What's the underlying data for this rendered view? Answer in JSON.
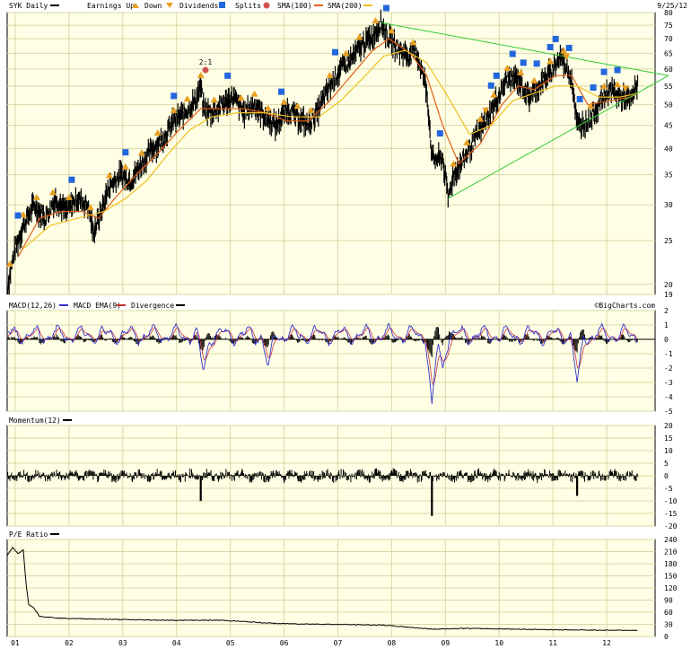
{
  "header": {
    "ticker_label": "SYK Daily",
    "earnings_up_label": "Earnings Up",
    "earnings_down_label": "Down",
    "dividends_label": "Dividends",
    "splits_label": "Splits",
    "sma100_label": "SMA(100)",
    "sma200_label": "SMA(200)",
    "date": "9/25/12"
  },
  "colors": {
    "price": "#000000",
    "sma100": "#e0601a",
    "sma200": "#f0c020",
    "trendline": "#33cc33",
    "panel_bg": "#ffffe5",
    "grid": "#d8d8a8",
    "macd": "#3333cc",
    "macd_ema": "#cc3333",
    "earnings_marker": "#e8a020",
    "dividend_marker": "#2266dd",
    "split_marker": "#d05050"
  },
  "split_annotation": "2:1",
  "watermark": "©BigCharts.com",
  "macd_panel": {
    "macd_label": "MACD(12,26)",
    "ema_label": "MACD EMA(9)",
    "divergence_label": "Divergence"
  },
  "momentum_panel": {
    "label": "Momentum(12)"
  },
  "pe_panel": {
    "label": "P/E Ratio"
  },
  "chart_data": [
    {
      "type": "line",
      "title": "SYK Daily",
      "x": [
        "01",
        "02",
        "03",
        "04",
        "05",
        "06",
        "07",
        "08",
        "09",
        "10",
        "11",
        "12"
      ],
      "yscale": "log",
      "ylim": [
        19,
        80
      ],
      "yticks": [
        "80",
        "75",
        "70",
        "65",
        "60",
        "55",
        "50",
        "45",
        "40",
        "35",
        "30",
        "25",
        "20",
        "19"
      ],
      "series": [
        {
          "name": "SYK Daily",
          "points": [
            [
              2001.0,
              19.5
            ],
            [
              2001.15,
              24
            ],
            [
              2001.3,
              27
            ],
            [
              2001.5,
              30
            ],
            [
              2001.7,
              28
            ],
            [
              2001.9,
              31
            ],
            [
              2002.1,
              29
            ],
            [
              2002.3,
              31
            ],
            [
              2002.5,
              30
            ],
            [
              2002.6,
              26
            ],
            [
              2002.75,
              29
            ],
            [
              2002.9,
              33
            ],
            [
              2003.1,
              35
            ],
            [
              2003.3,
              34
            ],
            [
              2003.5,
              37
            ],
            [
              2003.7,
              40
            ],
            [
              2003.9,
              42
            ],
            [
              2004.1,
              46
            ],
            [
              2004.3,
              48
            ],
            [
              2004.5,
              51
            ],
            [
              2004.6,
              55
            ],
            [
              2004.65,
              49
            ],
            [
              2004.8,
              48
            ],
            [
              2005.0,
              50
            ],
            [
              2005.2,
              52
            ],
            [
              2005.4,
              48
            ],
            [
              2005.6,
              50
            ],
            [
              2005.8,
              47
            ],
            [
              2006.0,
              45
            ],
            [
              2006.2,
              49
            ],
            [
              2006.4,
              47
            ],
            [
              2006.6,
              45
            ],
            [
              2006.8,
              49
            ],
            [
              2007.0,
              55
            ],
            [
              2007.2,
              60
            ],
            [
              2007.4,
              63
            ],
            [
              2007.6,
              68
            ],
            [
              2007.8,
              71
            ],
            [
              2007.95,
              76
            ],
            [
              2008.1,
              70
            ],
            [
              2008.3,
              66
            ],
            [
              2008.5,
              64
            ],
            [
              2008.6,
              66
            ],
            [
              2008.8,
              54
            ],
            [
              2008.9,
              38
            ],
            [
              2009.1,
              38
            ],
            [
              2009.2,
              31
            ],
            [
              2009.3,
              35
            ],
            [
              2009.5,
              38
            ],
            [
              2009.7,
              42
            ],
            [
              2009.9,
              46
            ],
            [
              2010.1,
              51
            ],
            [
              2010.3,
              57
            ],
            [
              2010.5,
              57
            ],
            [
              2010.7,
              52
            ],
            [
              2010.9,
              55
            ],
            [
              2011.1,
              59
            ],
            [
              2011.3,
              64
            ],
            [
              2011.5,
              57
            ],
            [
              2011.6,
              45
            ],
            [
              2011.8,
              46
            ],
            [
              2012.0,
              50
            ],
            [
              2012.2,
              54
            ],
            [
              2012.4,
              52
            ],
            [
              2012.6,
              51
            ],
            [
              2012.73,
              56
            ]
          ]
        },
        {
          "name": "SMA(100)",
          "points": [
            [
              2001.2,
              23
            ],
            [
              2001.6,
              28
            ],
            [
              2002.0,
              29
            ],
            [
              2002.4,
              29
            ],
            [
              2002.7,
              28
            ],
            [
              2003.0,
              31
            ],
            [
              2003.4,
              35
            ],
            [
              2003.8,
              39
            ],
            [
              2004.2,
              44
            ],
            [
              2004.6,
              49
            ],
            [
              2005.0,
              49
            ],
            [
              2005.4,
              49
            ],
            [
              2005.8,
              48
            ],
            [
              2006.2,
              46
            ],
            [
              2006.6,
              46
            ],
            [
              2007.0,
              51
            ],
            [
              2007.4,
              58
            ],
            [
              2007.8,
              66
            ],
            [
              2008.1,
              70
            ],
            [
              2008.5,
              65
            ],
            [
              2008.8,
              58
            ],
            [
              2009.1,
              45
            ],
            [
              2009.4,
              37
            ],
            [
              2009.8,
              41
            ],
            [
              2010.2,
              50
            ],
            [
              2010.5,
              55
            ],
            [
              2010.8,
              54
            ],
            [
              2011.2,
              58
            ],
            [
              2011.5,
              58
            ],
            [
              2011.8,
              50
            ],
            [
              2012.2,
              51
            ],
            [
              2012.6,
              52
            ],
            [
              2012.73,
              53
            ]
          ]
        },
        {
          "name": "SMA(200)",
          "points": [
            [
              2001.3,
              24
            ],
            [
              2001.8,
              27
            ],
            [
              2002.3,
              28
            ],
            [
              2002.8,
              29
            ],
            [
              2003.2,
              31
            ],
            [
              2003.6,
              34
            ],
            [
              2004.0,
              39
            ],
            [
              2004.4,
              44
            ],
            [
              2004.8,
              47
            ],
            [
              2005.3,
              48
            ],
            [
              2005.8,
              48
            ],
            [
              2006.3,
              47
            ],
            [
              2006.8,
              47
            ],
            [
              2007.2,
              51
            ],
            [
              2007.6,
              57
            ],
            [
              2008.0,
              64
            ],
            [
              2008.4,
              66
            ],
            [
              2008.8,
              62
            ],
            [
              2009.2,
              52
            ],
            [
              2009.6,
              43
            ],
            [
              2010.0,
              45
            ],
            [
              2010.4,
              51
            ],
            [
              2010.8,
              53
            ],
            [
              2011.2,
              55
            ],
            [
              2011.6,
              55
            ],
            [
              2012.0,
              52
            ],
            [
              2012.4,
              52
            ],
            [
              2012.73,
              53
            ]
          ]
        }
      ],
      "trendlines": [
        {
          "from": [
            2007.95,
            76
          ],
          "to": [
            2013.3,
            58
          ]
        },
        {
          "from": [
            2009.2,
            31
          ],
          "to": [
            2013.3,
            58
          ]
        }
      ]
    },
    {
      "type": "line",
      "title": "MACD(12,26)",
      "x": [
        "01",
        "02",
        "03",
        "04",
        "05",
        "06",
        "07",
        "08",
        "09",
        "10",
        "11",
        "12"
      ],
      "ylim": [
        -5,
        2
      ],
      "yticks": [
        "2",
        "1",
        "0",
        "-1",
        "-2",
        "-3",
        "-4",
        "-5"
      ],
      "min_points": [
        [
          2004.65,
          -2.3
        ],
        [
          2005.85,
          -2.0
        ],
        [
          2008.9,
          -4.5
        ],
        [
          2009.1,
          -2.0
        ],
        [
          2011.6,
          -3.0
        ]
      ]
    },
    {
      "type": "bar",
      "title": "Momentum(12)",
      "x": [
        "01",
        "02",
        "03",
        "04",
        "05",
        "06",
        "07",
        "08",
        "09",
        "10",
        "11",
        "12"
      ],
      "ylim": [
        -20,
        20
      ],
      "yticks": [
        "20",
        "15",
        "10",
        "5",
        "0",
        "-5",
        "-10",
        "-15",
        "-20"
      ],
      "spikes": [
        [
          2004.6,
          -10
        ],
        [
          2008.9,
          -16
        ],
        [
          2011.6,
          -8
        ]
      ]
    },
    {
      "type": "line",
      "title": "P/E Ratio",
      "x": [
        "01",
        "02",
        "03",
        "04",
        "05",
        "06",
        "07",
        "08",
        "09",
        "10",
        "11",
        "12"
      ],
      "ylim": [
        0,
        240
      ],
      "yticks": [
        "240",
        "210",
        "180",
        "150",
        "120",
        "90",
        "60",
        "30",
        "0"
      ],
      "series": [
        {
          "name": "P/E Ratio",
          "points": [
            [
              2001.0,
              200
            ],
            [
              2001.1,
              220
            ],
            [
              2001.2,
              205
            ],
            [
              2001.3,
              215
            ],
            [
              2001.35,
              130
            ],
            [
              2001.4,
              80
            ],
            [
              2001.5,
              70
            ],
            [
              2001.6,
              50
            ],
            [
              2002.0,
              45
            ],
            [
              2003.0,
              42
            ],
            [
              2004.0,
              40
            ],
            [
              2005.0,
              40
            ],
            [
              2006.0,
              32
            ],
            [
              2007.0,
              30
            ],
            [
              2008.0,
              28
            ],
            [
              2008.9,
              18
            ],
            [
              2009.5,
              20
            ],
            [
              2010.5,
              18
            ],
            [
              2011.5,
              16
            ],
            [
              2012.73,
              15
            ]
          ]
        }
      ]
    }
  ]
}
